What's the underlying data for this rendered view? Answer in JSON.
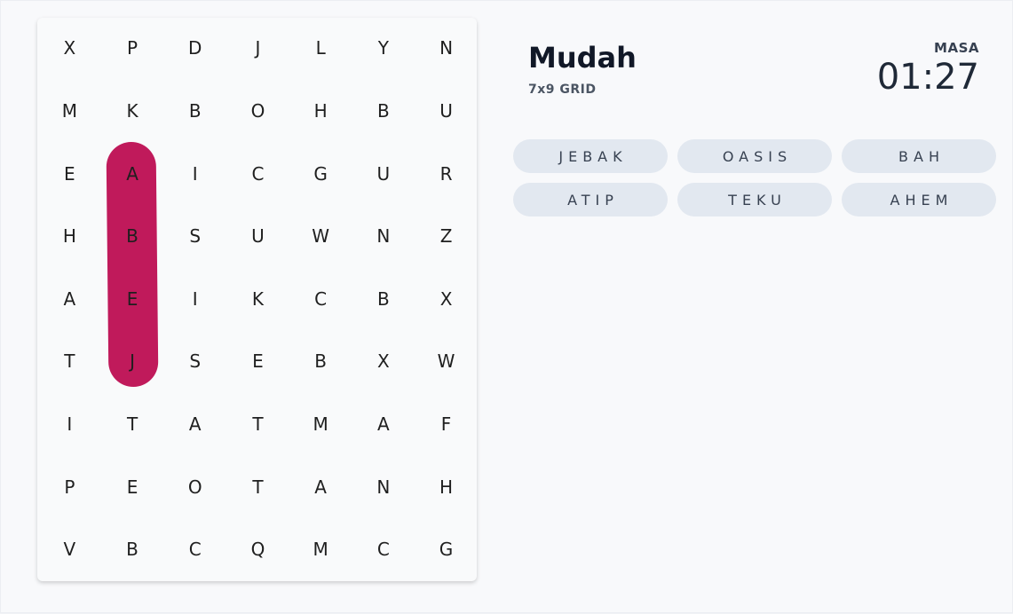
{
  "level": {
    "title": "Mudah",
    "grid_size": "7x9 GRID"
  },
  "timer": {
    "label": "MASA",
    "value": "01:27"
  },
  "grid": {
    "cols": 7,
    "rows": 9,
    "letters": [
      [
        "X",
        "P",
        "D",
        "J",
        "L",
        "Y",
        "N"
      ],
      [
        "M",
        "K",
        "B",
        "O",
        "H",
        "B",
        "U"
      ],
      [
        "E",
        "A",
        "I",
        "C",
        "G",
        "U",
        "R"
      ],
      [
        "H",
        "B",
        "S",
        "U",
        "W",
        "N",
        "Z"
      ],
      [
        "A",
        "E",
        "I",
        "K",
        "C",
        "B",
        "X"
      ],
      [
        "T",
        "J",
        "S",
        "E",
        "B",
        "X",
        "W"
      ],
      [
        "I",
        "T",
        "A",
        "T",
        "M",
        "A",
        "F"
      ],
      [
        "P",
        "E",
        "O",
        "T",
        "A",
        "N",
        "H"
      ],
      [
        "V",
        "B",
        "C",
        "Q",
        "M",
        "C",
        "G"
      ]
    ]
  },
  "found_highlights": [
    {
      "word": "JEBA",
      "start": [
        5,
        1
      ],
      "end": [
        2,
        1
      ],
      "color": "#c01a5b"
    }
  ],
  "words": [
    "JEBAK",
    "OASIS",
    "BAH",
    "ATIP",
    "TEKU",
    "AHEM"
  ],
  "colors": {
    "highlight": "#c01a5b",
    "chip_bg": "#e2e8f0",
    "background": "#f8f9fb"
  }
}
